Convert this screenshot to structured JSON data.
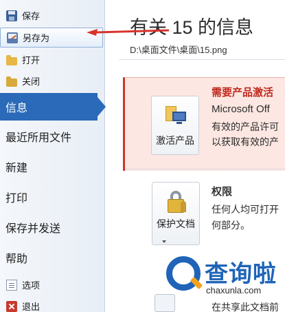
{
  "sidebar": {
    "commands_top": [
      {
        "label": "保存",
        "icon": "save-icon"
      },
      {
        "label": "另存为",
        "icon": "save-as-icon"
      },
      {
        "label": "打开",
        "icon": "open-folder-icon"
      },
      {
        "label": "关闭",
        "icon": "close-folder-icon"
      }
    ],
    "categories": [
      {
        "label": "信息",
        "active": true
      },
      {
        "label": "最近所用文件"
      },
      {
        "label": "新建"
      },
      {
        "label": "打印"
      },
      {
        "label": "保存并发送"
      },
      {
        "label": "帮助"
      }
    ],
    "commands_bottom": [
      {
        "label": "选项",
        "icon": "options-icon"
      },
      {
        "label": "退出",
        "icon": "exit-icon"
      }
    ]
  },
  "main": {
    "title": "有关 15 的信息",
    "path": "D:\\桌面文件\\桌面\\15.png",
    "activate": {
      "button_label": "激活产品",
      "heading": "需要产品激活",
      "lines": [
        "Microsoft Off",
        "有效的产品许可",
        "以获取有效的产"
      ]
    },
    "permissions": {
      "button_label": "保护文档",
      "heading": "权限",
      "lines": [
        "任何人均可打开",
        "何部分。"
      ]
    },
    "share": {
      "line": "在共享此文档前"
    }
  },
  "watermark": {
    "text": "查询啦",
    "url": "chaxunla.com"
  },
  "colors": {
    "accent_blue": "#2a6ab8",
    "warning_red": "#c0291f",
    "annotation_arrow": "#d8332b"
  }
}
